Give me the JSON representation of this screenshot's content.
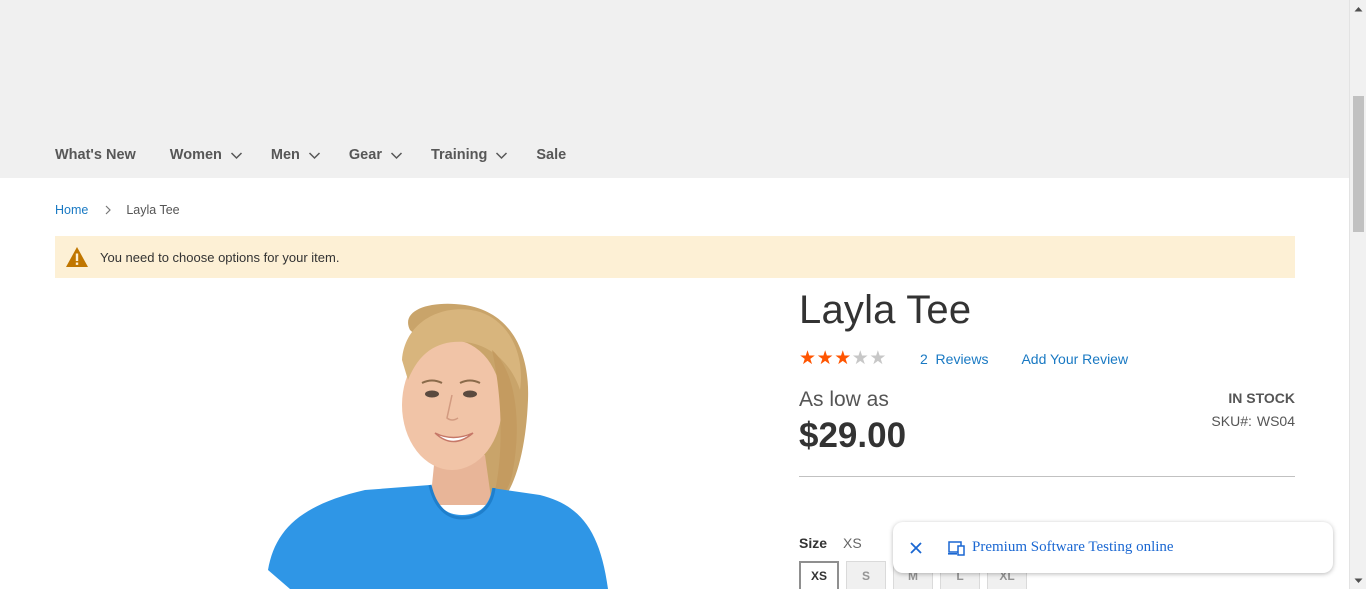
{
  "nav": {
    "items": [
      {
        "label": "What's New",
        "has_dropdown": false
      },
      {
        "label": "Women",
        "has_dropdown": true
      },
      {
        "label": "Men",
        "has_dropdown": true
      },
      {
        "label": "Gear",
        "has_dropdown": true
      },
      {
        "label": "Training",
        "has_dropdown": true
      },
      {
        "label": "Sale",
        "has_dropdown": false
      }
    ]
  },
  "breadcrumb": {
    "home": "Home",
    "current": "Layla Tee"
  },
  "notice": {
    "message": "You need to choose options for your item."
  },
  "product": {
    "title": "Layla Tee",
    "rating": {
      "filled": 3,
      "total": 5
    },
    "reviews_count": "2",
    "reviews_label": "Reviews",
    "add_review": "Add Your Review",
    "as_low_as": "As low as",
    "price": "$29.00",
    "stock": "IN STOCK",
    "sku_label": "SKU#:",
    "sku": "WS04",
    "size_label": "Size",
    "size_selected": "XS",
    "sizes": [
      "XS",
      "S",
      "M",
      "L",
      "XL"
    ]
  },
  "toast": {
    "text": "Premium Software Testing online"
  },
  "colors": {
    "link": "#1979c3",
    "star_filled": "#ff5501",
    "star_empty": "#c7c7c7",
    "notice_bg": "#fdf0d5",
    "warning": "#c07600"
  }
}
